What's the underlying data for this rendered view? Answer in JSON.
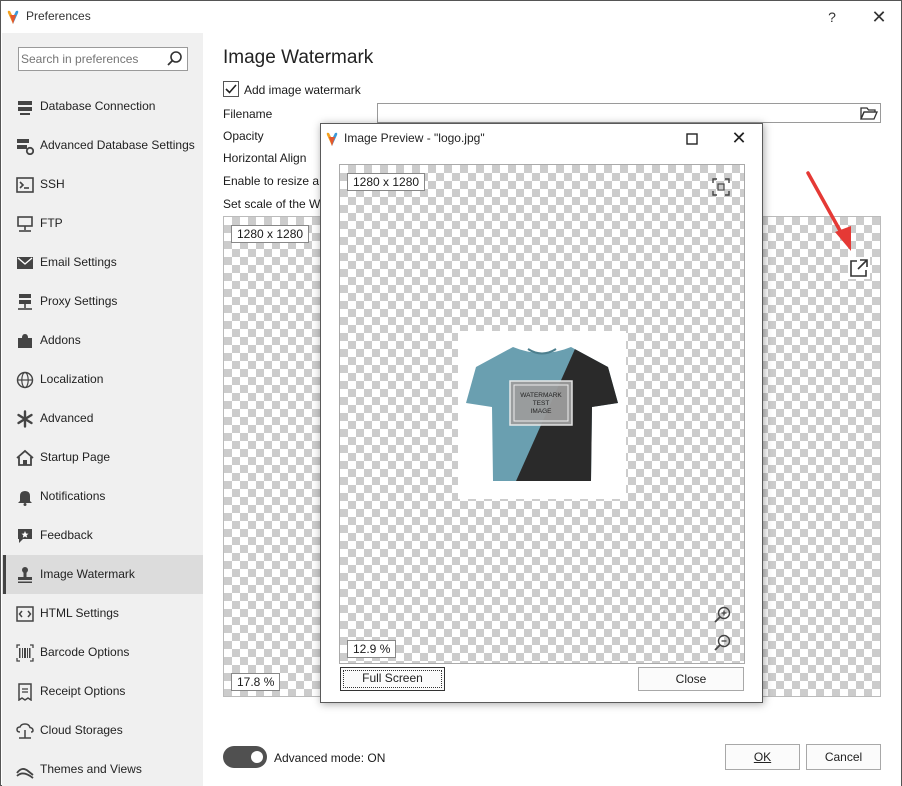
{
  "window": {
    "title": "Preferences",
    "help_symbol": "?",
    "close_symbol": "✕"
  },
  "sidebar": {
    "search_placeholder": "Search in preferences",
    "items": [
      {
        "label": "Database Connection",
        "icon": "database-connection-icon"
      },
      {
        "label": "Advanced Database Settings",
        "icon": "database-settings-icon"
      },
      {
        "label": "SSH",
        "icon": "terminal-icon"
      },
      {
        "label": "FTP",
        "icon": "ftp-icon"
      },
      {
        "label": "Email Settings",
        "icon": "envelope-icon"
      },
      {
        "label": "Proxy Settings",
        "icon": "proxy-icon"
      },
      {
        "label": "Addons",
        "icon": "puzzle-icon"
      },
      {
        "label": "Localization",
        "icon": "globe-icon"
      },
      {
        "label": "Advanced",
        "icon": "asterisk-icon"
      },
      {
        "label": "Startup Page",
        "icon": "home-icon"
      },
      {
        "label": "Notifications",
        "icon": "bell-icon"
      },
      {
        "label": "Feedback",
        "icon": "feedback-icon"
      },
      {
        "label": "Image Watermark",
        "icon": "stamp-icon",
        "active": true
      },
      {
        "label": "HTML Settings",
        "icon": "code-icon"
      },
      {
        "label": "Barcode Options",
        "icon": "barcode-icon"
      },
      {
        "label": "Receipt Options",
        "icon": "receipt-icon"
      },
      {
        "label": "Cloud Storages",
        "icon": "cloud-icon"
      },
      {
        "label": "Themes and Views",
        "icon": "palette-icon"
      }
    ]
  },
  "main": {
    "title": "Image Watermark",
    "add_watermark_label": "Add image watermark",
    "add_watermark_checked": true,
    "filename_label": "Filename",
    "filename_value": "",
    "opacity_label": "Opacity",
    "halign_label": "Horizontal Align",
    "resize_label": "Enable to resize a w",
    "scale_label": "Set scale of the Wa",
    "preview_dimensions": "1280 x 1280",
    "preview_zoom": "17.8 %",
    "advanced_mode_label": "Advanced mode: ON",
    "advanced_mode_on": true,
    "ok_label": "OK",
    "cancel_label": "Cancel"
  },
  "dialog": {
    "title": "Image Preview - \"logo.jpg\"",
    "dimensions": "1280 x 1280",
    "zoom": "12.9 %",
    "fullscreen_label": "Full Screen",
    "close_label": "Close",
    "close_symbol": "✕",
    "watermark_text": [
      "WATERMARK",
      "TEST",
      "IMAGE"
    ]
  },
  "colors": {
    "accent_arrow": "#e53935",
    "shirt_blue": "#6a9fb0",
    "shirt_black": "#2a2a2a",
    "toggle_on": "#505050"
  }
}
